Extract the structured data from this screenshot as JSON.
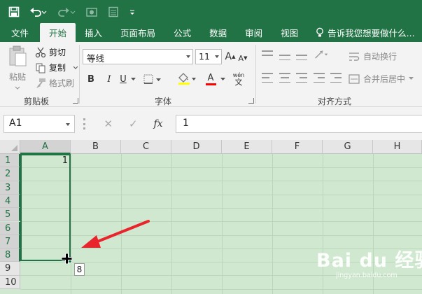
{
  "tabs": [
    "文件",
    "开始",
    "插入",
    "页面布局",
    "公式",
    "数据",
    "审阅",
    "视图"
  ],
  "active_tab": "开始",
  "tell_me": "告诉我您想要做什么...",
  "clipboard": {
    "paste": "粘贴",
    "cut": "剪切",
    "copy": "复制",
    "format_painter": "格式刷",
    "group": "剪贴板"
  },
  "font": {
    "name": "等线",
    "size": "11",
    "group": "字体",
    "bold": "B",
    "italic": "I",
    "underline": "U",
    "font_color_glyph": "A",
    "pinyin_glyph": "wén",
    "wen_glyph": "文",
    "grow_glyph": "A",
    "shrink_glyph": "A"
  },
  "alignment": {
    "wrap": "自动换行",
    "merge": "合并后居中",
    "group": "对齐方式"
  },
  "formula_bar": {
    "name_box": "A1",
    "cancel": "✕",
    "enter": "✓",
    "fx": "fx",
    "value": "1"
  },
  "columns": [
    "A",
    "B",
    "C",
    "D",
    "E",
    "F",
    "G",
    "H"
  ],
  "rows": [
    "1",
    "2",
    "3",
    "4",
    "5",
    "6",
    "7",
    "8",
    "9",
    "10"
  ],
  "cells": {
    "A1": "1"
  },
  "fill_tooltip": "8",
  "watermark": {
    "main": "Bai du 经验",
    "sub": "jingyan.baidu.com"
  },
  "colors": {
    "accent": "#217346",
    "sheet": "#cfe8cf",
    "arrow": "#e8252c",
    "font_color_bar": "#ff0000"
  }
}
